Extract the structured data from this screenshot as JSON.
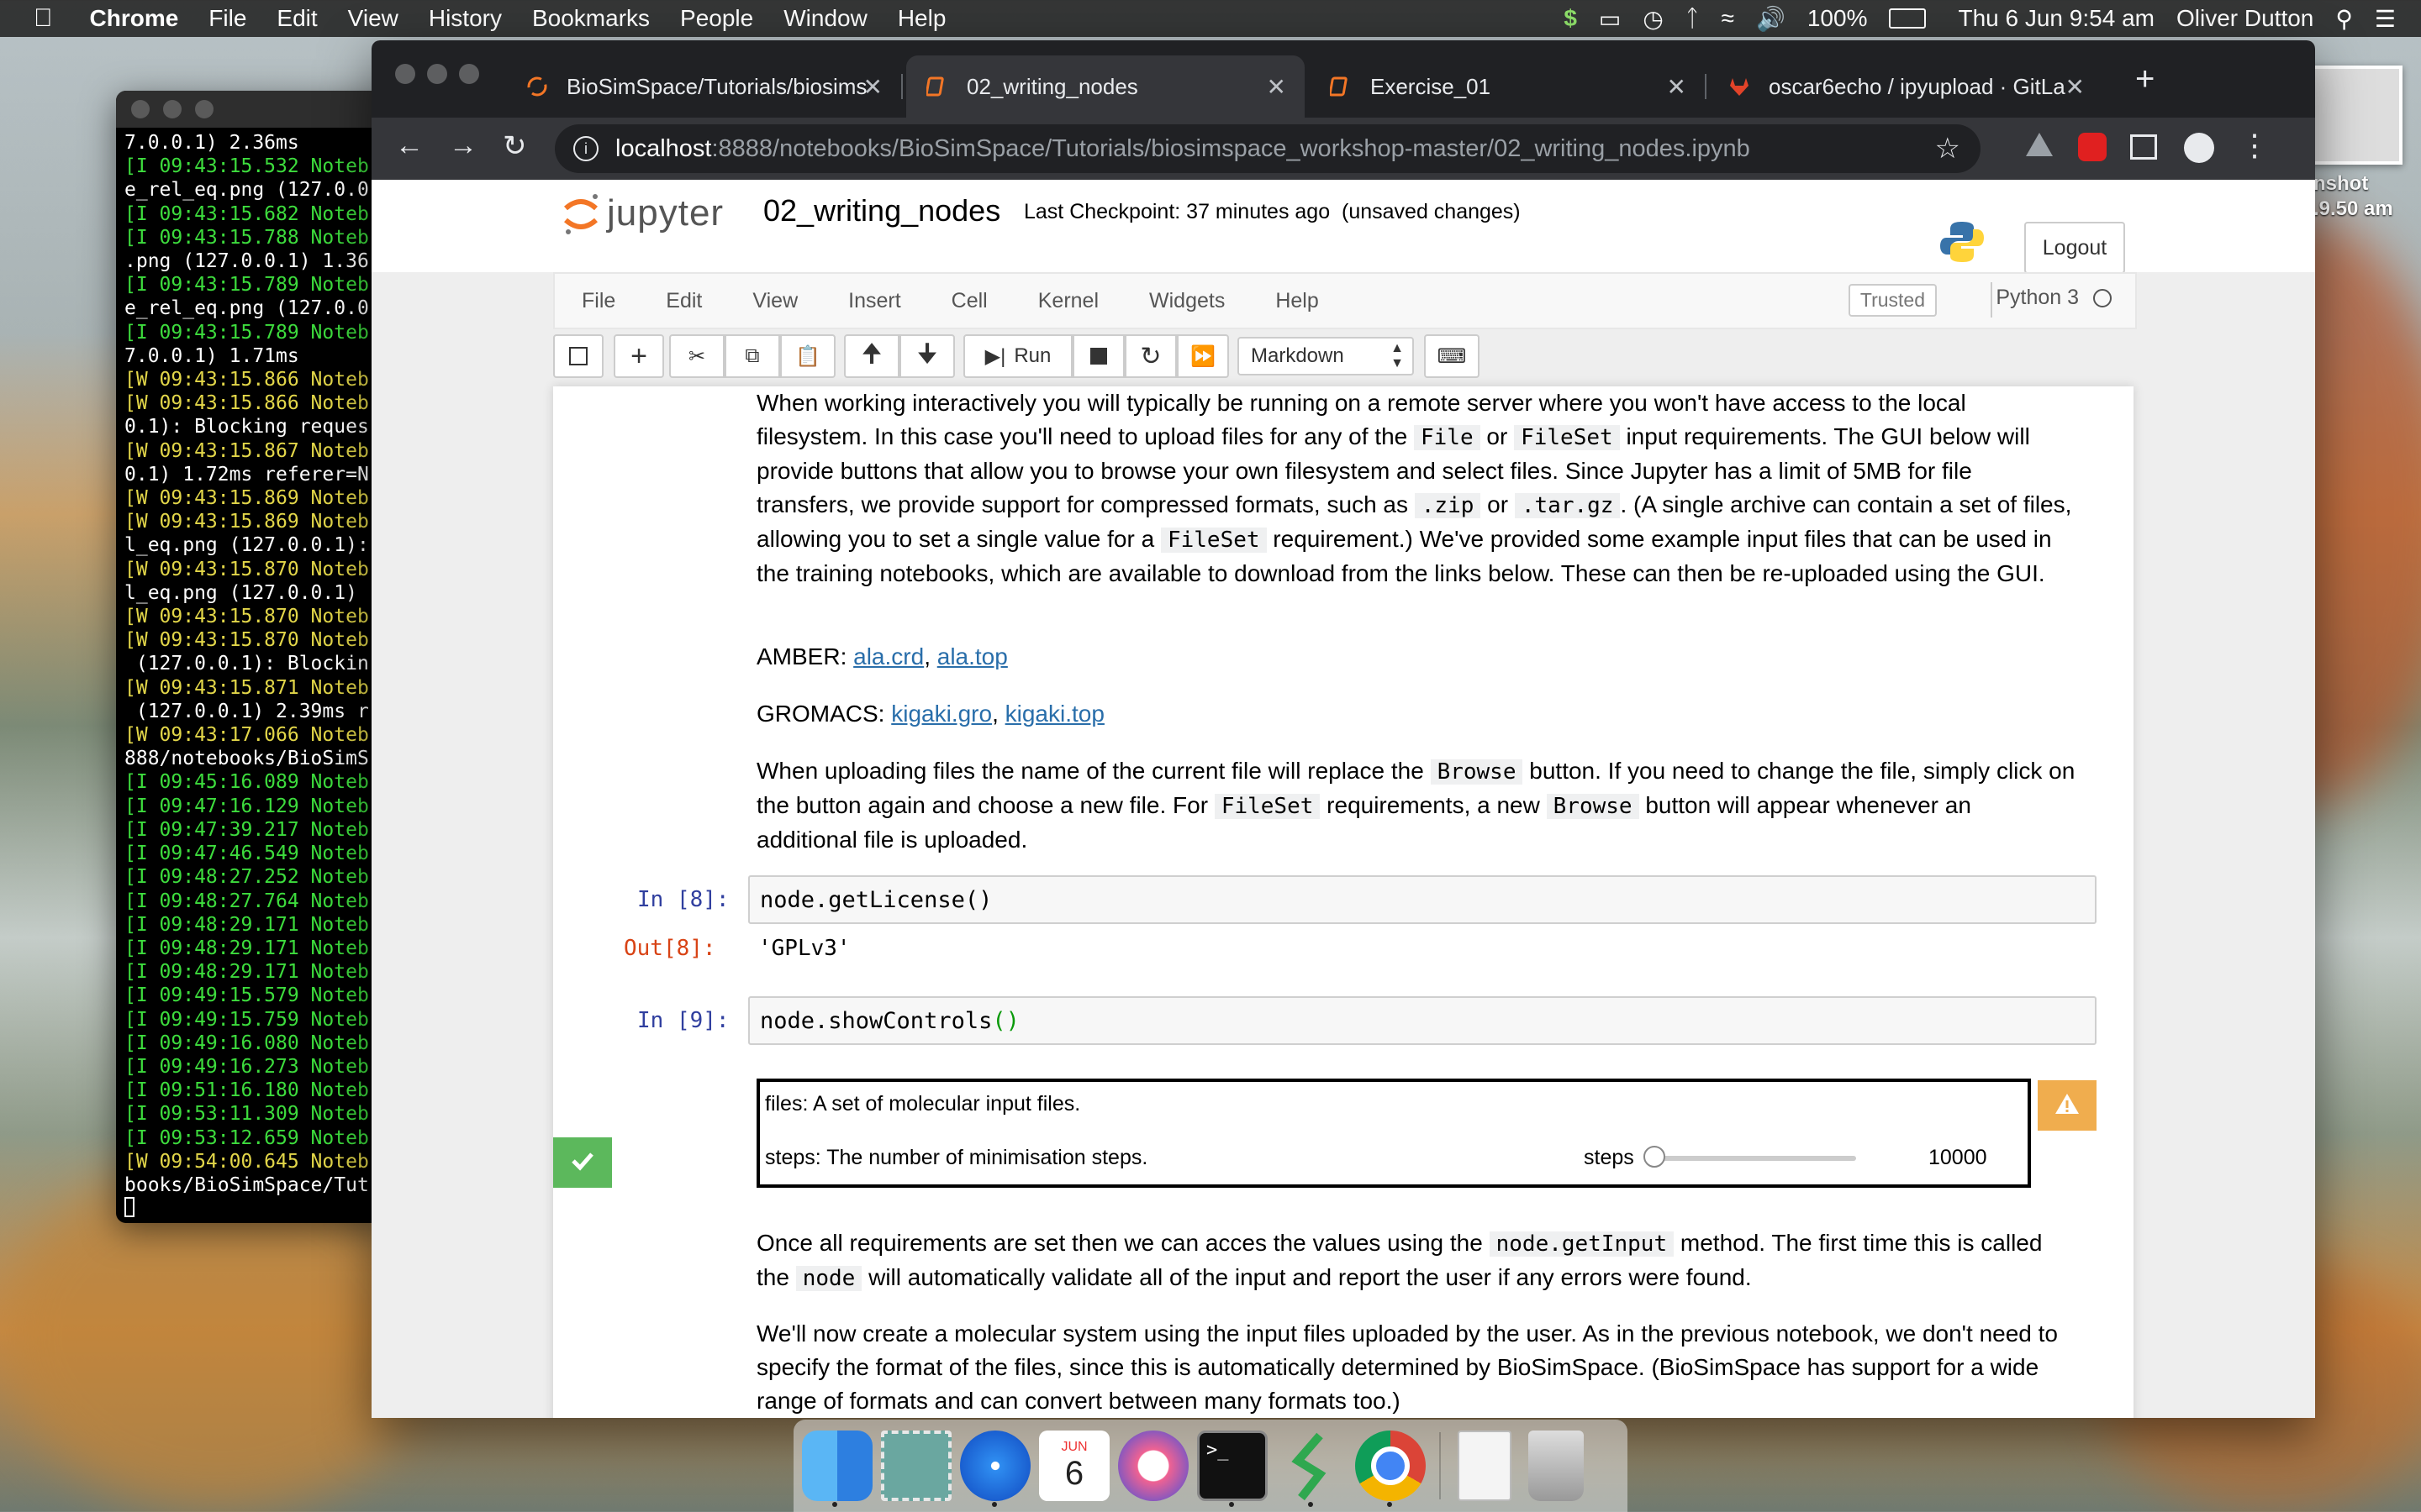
{
  "menubar": {
    "app": "Chrome",
    "items": [
      "File",
      "Edit",
      "View",
      "History",
      "Bookmarks",
      "People",
      "Window",
      "Help"
    ],
    "battery": "100%",
    "datetime": "Thu 6 Jun  9:54 am",
    "user": "Oliver Dutton"
  },
  "terminal": {
    "lines": [
      {
        "t": "7.0.0.1) 2.36ms",
        "c": "w"
      },
      {
        "t": "[I 09:43:15.532 Noteb",
        "c": "g"
      },
      {
        "t": "e_rel_eq.png (127.0.0",
        "c": "w"
      },
      {
        "t": "[I 09:43:15.682 Noteb",
        "c": "g"
      },
      {
        "t": "[I 09:43:15.788 Noteb",
        "c": "g"
      },
      {
        "t": ".png (127.0.0.1) 1.36",
        "c": "w"
      },
      {
        "t": "[I 09:43:15.789 Noteb",
        "c": "g"
      },
      {
        "t": "e_rel_eq.png (127.0.0",
        "c": "w"
      },
      {
        "t": "[I 09:43:15.789 Noteb",
        "c": "g"
      },
      {
        "t": "7.0.0.1) 1.71ms",
        "c": "w"
      },
      {
        "t": "[W 09:43:15.866 Noteb",
        "c": "y"
      },
      {
        "t": "[W 09:43:15.866 Noteb",
        "c": "y"
      },
      {
        "t": "0.1): Blocking reques",
        "c": "w"
      },
      {
        "t": "[W 09:43:15.867 Noteb",
        "c": "y"
      },
      {
        "t": "0.1) 1.72ms referer=N",
        "c": "w"
      },
      {
        "t": "[W 09:43:15.869 Noteb",
        "c": "y"
      },
      {
        "t": "[W 09:43:15.869 Noteb",
        "c": "y"
      },
      {
        "t": "l_eq.png (127.0.0.1):",
        "c": "w"
      },
      {
        "t": "[W 09:43:15.870 Noteb",
        "c": "y"
      },
      {
        "t": "l_eq.png (127.0.0.1)",
        "c": "w"
      },
      {
        "t": "[W 09:43:15.870 Noteb",
        "c": "y"
      },
      {
        "t": "[W 09:43:15.870 Noteb",
        "c": "y"
      },
      {
        "t": " (127.0.0.1): Blockin",
        "c": "w"
      },
      {
        "t": "[W 09:43:15.871 Noteb",
        "c": "y"
      },
      {
        "t": " (127.0.0.1) 2.39ms r",
        "c": "w"
      },
      {
        "t": "[W 09:43:17.066 Noteb",
        "c": "y"
      },
      {
        "t": "888/notebooks/BioSimS",
        "c": "w"
      },
      {
        "t": "[I 09:45:16.089 Noteb",
        "c": "g"
      },
      {
        "t": "[I 09:47:16.129 Noteb",
        "c": "g"
      },
      {
        "t": "[I 09:47:39.217 Noteb",
        "c": "g"
      },
      {
        "t": "[I 09:47:46.549 Noteb",
        "c": "g"
      },
      {
        "t": "[I 09:48:27.252 Noteb",
        "c": "g"
      },
      {
        "t": "[I 09:48:27.764 Noteb",
        "c": "g"
      },
      {
        "t": "[I 09:48:29.171 Noteb",
        "c": "g"
      },
      {
        "t": "[I 09:48:29.171 Noteb",
        "c": "g"
      },
      {
        "t": "[I 09:48:29.171 Noteb",
        "c": "g"
      },
      {
        "t": "[I 09:49:15.579 Noteb",
        "c": "g"
      },
      {
        "t": "[I 09:49:15.759 Noteb",
        "c": "g"
      },
      {
        "t": "[I 09:49:16.080 Noteb",
        "c": "g"
      },
      {
        "t": "[I 09:49:16.273 Noteb",
        "c": "g"
      },
      {
        "t": "[I 09:51:16.180 Noteb",
        "c": "g"
      },
      {
        "t": "[I 09:53:11.309 Noteb",
        "c": "g"
      },
      {
        "t": "[I 09:53:12.659 Noteb",
        "c": "g"
      },
      {
        "t": "[W 09:54:00.645 Noteb",
        "c": "y"
      },
      {
        "t": "books/BioSimSpace/Tut",
        "c": "w"
      }
    ]
  },
  "desktop_thumb": {
    "line1": "nshot",
    "line2": ".9.50 am"
  },
  "tabs": [
    {
      "title": "BioSimSpace/Tutorials/biosims"
    },
    {
      "title": "02_writing_nodes"
    },
    {
      "title": "Exercise_01"
    },
    {
      "title": "oscar6echo / ipyupload · GitLa"
    }
  ],
  "omnibox": {
    "host": "localhost",
    "path": ":8888/notebooks/BioSimSpace/Tutorials/biosimspace_workshop-master/02_writing_nodes.ipynb"
  },
  "jupyter": {
    "logo": "jupyter",
    "notebook_name": "02_writing_nodes",
    "checkpoint": "Last Checkpoint: 37 minutes ago  (unsaved changes)",
    "logout": "Logout",
    "menu": [
      "File",
      "Edit",
      "View",
      "Insert",
      "Cell",
      "Kernel",
      "Widgets",
      "Help"
    ],
    "trusted": "Trusted",
    "kernel": "Python 3",
    "run": "Run",
    "cell_type": "Markdown"
  },
  "cells": {
    "p1_a": "When working interactively you will typically be running on a remote server where you won't have access to the local filesystem. In this case you'll need to upload files for any of the ",
    "p1_code1": "File",
    "p1_or1": " or ",
    "p1_code2": "FileSet",
    "p1_b": " input requirements. The GUI below will provide buttons that allow you to browse your own filesystem and select files. Since Jupyter has a limit of 5MB for file transfers, we provide support for compressed formats, such as ",
    "p1_code3": ".zip",
    "p1_or2": " or ",
    "p1_code4": ".tar.gz",
    "p1_c": ". (A single archive can contain a set of files, allowing you to set a single value for a ",
    "p1_code5": "FileSet",
    "p1_d": " requirement.) We've provided some example input files that can be used in the training notebooks, which are available to download from the links below. These can then be re-uploaded using the GUI.",
    "amber_label": "AMBER: ",
    "amber_link1": "ala.crd",
    "amber_link2": "ala.top",
    "gromacs_label": "GROMACS: ",
    "gromacs_link1": "kigaki.gro",
    "gromacs_link2": "kigaki.top",
    "p2_a": "When uploading files the name of the current file will replace the ",
    "p2_code1": "Browse",
    "p2_b": " button. If you need to change the file, simply click on the button again and choose a new file. For ",
    "p2_code2": "FileSet",
    "p2_c": " requirements, a new ",
    "p2_code3": "Browse",
    "p2_d": " button will appear whenever an additional file is uploaded.",
    "in8": "In [8]:",
    "code8": "node.getLicense()",
    "out8": "Out[8]:",
    "out8_val": "'GPLv3'",
    "in9": "In [9]:",
    "code9_a": "node.showControls",
    "code9_b": "()",
    "widget_files": "files: A set of molecular input files.",
    "widget_steps": "steps: The number of minimisation steps.",
    "slider_label": "steps",
    "slider_value": "10000",
    "slider_fraction": 0.0,
    "p3_a": "Once all requirements are set then we can acces the values using the ",
    "p3_code1": "node.getInput",
    "p3_b": " method. The first time this is called the ",
    "p3_code2": "node",
    "p3_c": " will automatically validate all of the input and report the user if any errors were found.",
    "p4": "We'll now create a molecular system using the input files uploaded by the user. As in the previous notebook, we don't need to specify the format of the files, since this is automatically determined by BioSimSpace. (BioSimSpace has support for a wide range of formats and can convert between many formats too.)"
  },
  "dock": {
    "calendar_month": "JUN",
    "calendar_day": "6",
    "icons": [
      "finder-icon",
      "stamp-app-icon",
      "safari-icon",
      "calendar-icon",
      "itunes-icon",
      "terminal-icon",
      "app-s-icon",
      "chrome-icon",
      "text-document-icon",
      "trash-icon"
    ]
  },
  "colors": {
    "accent": "#f37626",
    "link": "#296eaa",
    "warning": "#f0ad4e",
    "success": "#5cb85c"
  }
}
